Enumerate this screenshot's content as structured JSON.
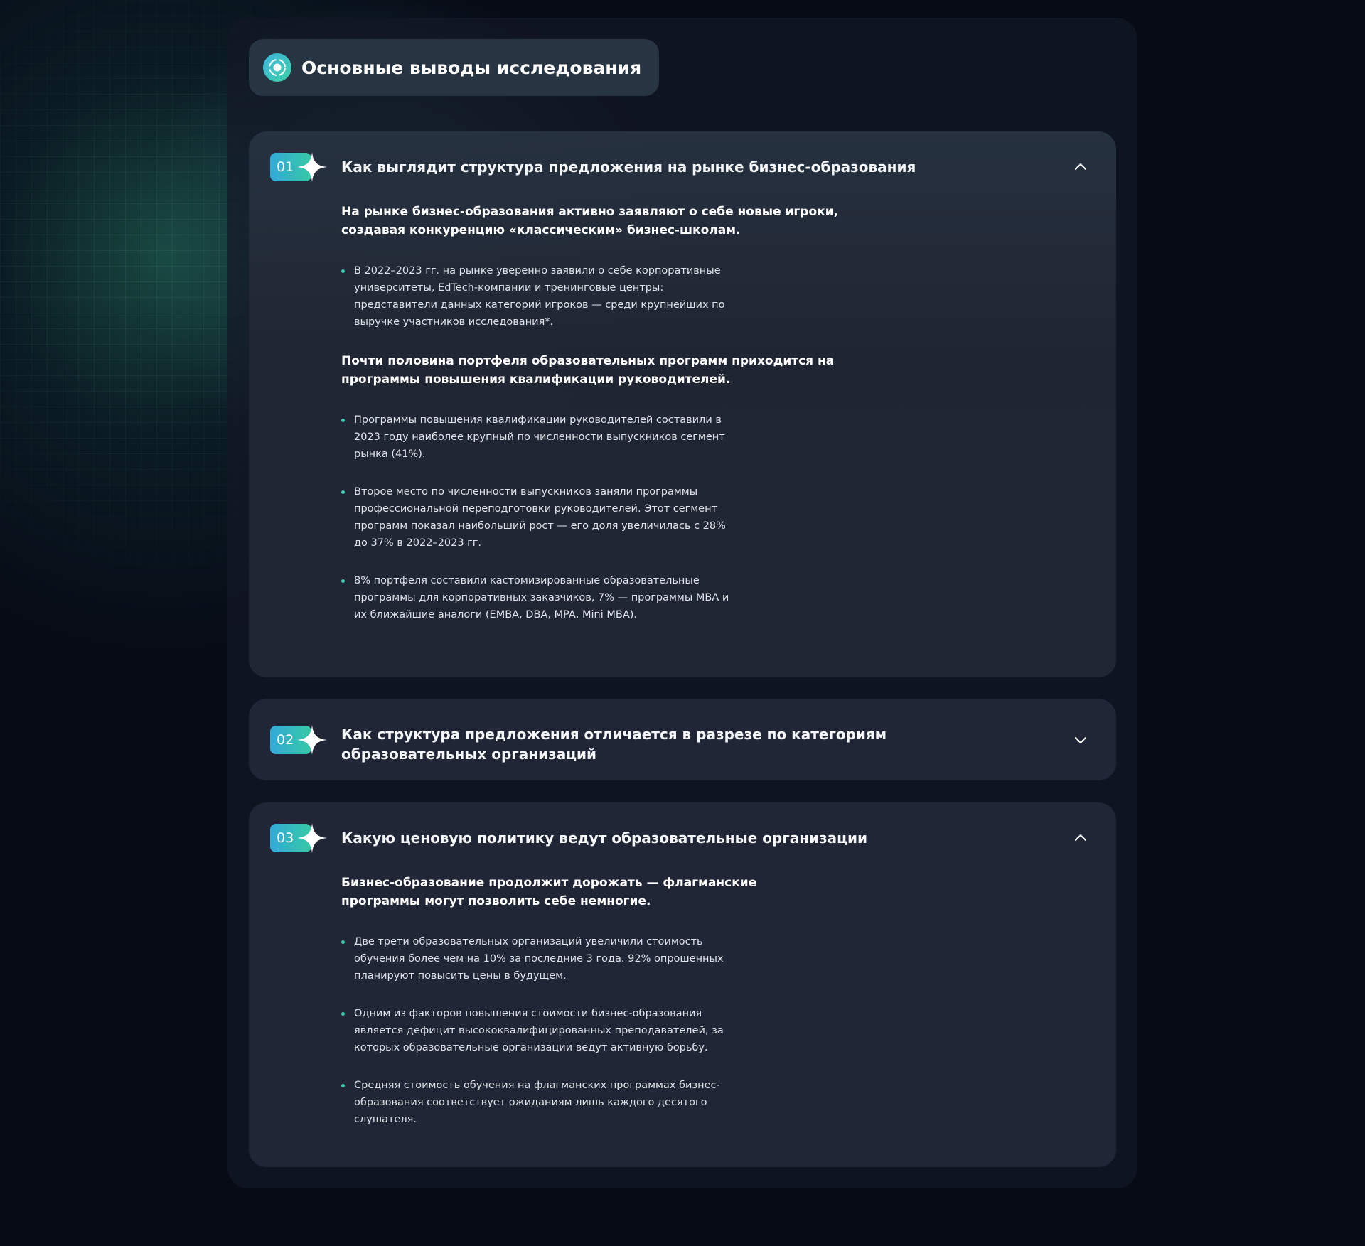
{
  "header": {
    "title": "Основные выводы исследования"
  },
  "sections": [
    {
      "number": "01",
      "title": "Как выглядит структура предложения на рынке бизнес-образования",
      "state": "expanded",
      "blocks": [
        {
          "lead": "На рынке бизнес-образования активно заявляют о себе новые игроки, создавая конкуренцию «классическим» бизнес-школам.",
          "bullets": [
            "В 2022–2023 гг. на рынке уверенно заявили о себе корпоративные университеты, EdTech-компании и тренинговые центры: представители данных категорий игроков — среди крупнейших по выручке участников исследования*."
          ]
        },
        {
          "lead": "Почти половина портфеля образовательных программ приходится на программы повышения квалификации руководителей.",
          "bullets": [
            "Программы повышения квалификации руководителей составили в 2023 году наиболее крупный по численности выпускников сегмент рынка (41%).",
            "Второе место по численности выпускников заняли программы профессиональной переподготовки руководителей. Этот сегмент программ показал наибольший рост — его доля увеличилась с 28% до 37% в 2022–2023 гг.",
            "8% портфеля составили кастомизированные образовательные программы для корпоративных заказчиков, 7% — программы MBA и их ближайшие аналоги (EMBA, DBA, MPA, Mini MBA)."
          ]
        }
      ]
    },
    {
      "number": "02",
      "title": "Как структура предложения отличается в разрезе по категориям образовательных организаций",
      "state": "collapsed"
    },
    {
      "number": "03",
      "title": "Какую ценовую политику ведут образовательные организации",
      "state": "expanded",
      "blocks": [
        {
          "lead": "Бизнес-образование продолжит дорожать — флагманские программы могут позволить себе немногие.",
          "bullets": [
            "Две трети образовательных организаций увеличили стоимость обучения более чем на 10% за последние 3 года. 92% опрошенных планируют повысить цены в будущем.",
            "Одним из факторов повышения стоимости бизнес-образования является дефицит высококвалифицированных преподавателей, за которых образовательные организации ведут активную борьбу.",
            "Средняя стоимость обучения на флагманских программах бизнес-образования соответствует ожиданиям лишь каждого десятого слушателя."
          ]
        }
      ]
    }
  ],
  "icons": {
    "header": "target-ring-icon",
    "badge": "sparkle-icon",
    "expanded": "chevron-up-icon",
    "collapsed": "chevron-down-icon"
  },
  "colors": {
    "accent_start": "#33a9d8",
    "accent_end": "#36c9a6",
    "bullet": "#3ccbb0",
    "background": "#070b16",
    "card": "#222736"
  }
}
